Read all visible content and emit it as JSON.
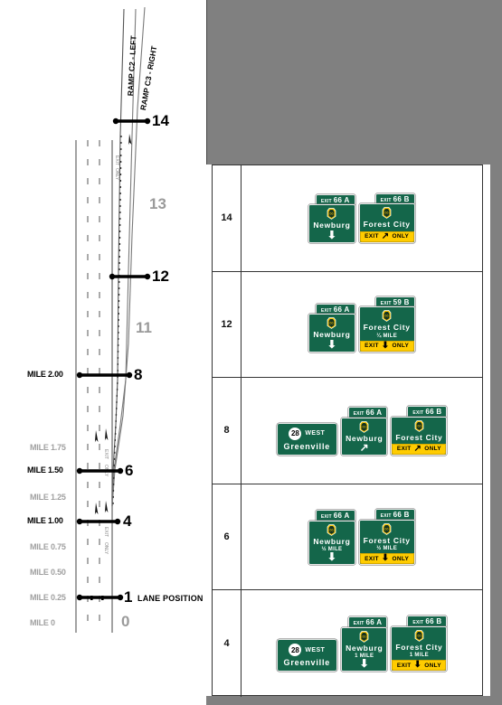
{
  "figure": {
    "kind": "freeway-exit-signing-diagram",
    "lane_position_caption": "LANE POSITION"
  },
  "diagram": {
    "ramp_labels": [
      {
        "id": "ramp-c2-left",
        "text": "RAMP C2 - LEFT"
      },
      {
        "id": "ramp-c3-right",
        "text": "RAMP C3 - RIGHT"
      }
    ],
    "mile_marks": [
      {
        "id": "mile-2-00",
        "text": "MILE 2.00",
        "emphasis": "major"
      },
      {
        "id": "mile-1-75",
        "text": "MILE 1.75",
        "emphasis": "minor"
      },
      {
        "id": "mile-1-50",
        "text": "MILE 1.50",
        "emphasis": "major"
      },
      {
        "id": "mile-1-25",
        "text": "MILE 1.25",
        "emphasis": "minor"
      },
      {
        "id": "mile-1-00",
        "text": "MILE 1.00",
        "emphasis": "major"
      },
      {
        "id": "mile-0-75",
        "text": "MILE 0.75",
        "emphasis": "minor"
      },
      {
        "id": "mile-0-50",
        "text": "MILE 0.50",
        "emphasis": "minor"
      },
      {
        "id": "mile-0-25",
        "text": "MILE 0.25",
        "emphasis": "minor"
      },
      {
        "id": "mile-0",
        "text": "MILE 0",
        "emphasis": "minor"
      }
    ],
    "position_numbers": [
      {
        "id": "pos-14",
        "text": "14",
        "emphasis": "major"
      },
      {
        "id": "pos-13",
        "text": "13",
        "emphasis": "minor"
      },
      {
        "id": "pos-12",
        "text": "12",
        "emphasis": "major"
      },
      {
        "id": "pos-11",
        "text": "11",
        "emphasis": "minor"
      },
      {
        "id": "pos-8",
        "text": "8",
        "emphasis": "major"
      },
      {
        "id": "pos-6",
        "text": "6",
        "emphasis": "major"
      },
      {
        "id": "pos-4",
        "text": "4",
        "emphasis": "major"
      },
      {
        "id": "pos-1",
        "text": "1",
        "emphasis": "major"
      },
      {
        "id": "pos-0",
        "text": "0",
        "emphasis": "minor"
      }
    ]
  },
  "table": {
    "rows": [
      {
        "position": "14",
        "signs": [
          {
            "type": "guide",
            "exit_tab": {
              "word": "EXIT",
              "number": "66 A"
            },
            "tab_align": "right",
            "shield": "keystone-shield-icon",
            "destination": "Newburg",
            "distance": "",
            "arrow": "down",
            "exit_only": null
          },
          {
            "type": "guide",
            "exit_tab": {
              "word": "EXIT",
              "number": "66 B"
            },
            "tab_align": "right",
            "shield": "keystone-shield-icon",
            "destination": "Forest City",
            "distance": "",
            "arrow": null,
            "exit_only": {
              "left": "EXIT",
              "arrow": "diagonal",
              "right": "ONLY"
            }
          }
        ]
      },
      {
        "position": "12",
        "signs": [
          {
            "type": "guide",
            "exit_tab": {
              "word": "EXIT",
              "number": "66 A"
            },
            "tab_align": "right",
            "shield": "keystone-shield-icon",
            "destination": "Newburg",
            "distance": "",
            "arrow": "down",
            "exit_only": null
          },
          {
            "type": "guide",
            "exit_tab": {
              "word": "EXIT",
              "number": "59 B"
            },
            "tab_align": "right",
            "shield": "keystone-shield-icon",
            "destination": "Forest City",
            "distance": "¼ MILE",
            "arrow": null,
            "exit_only": {
              "left": "EXIT",
              "arrow": "down",
              "right": "ONLY"
            }
          }
        ]
      },
      {
        "position": "8",
        "signs": [
          {
            "type": "route",
            "route_number": "28",
            "direction": "WEST",
            "destination": "Greenville"
          },
          {
            "type": "guide",
            "exit_tab": {
              "word": "EXIT",
              "number": "66 A"
            },
            "tab_align": "right",
            "shield": "keystone-shield-icon",
            "destination": "Newburg",
            "distance": "",
            "arrow": "diagonal",
            "exit_only": null
          },
          {
            "type": "guide",
            "exit_tab": {
              "word": "EXIT",
              "number": "66 B"
            },
            "tab_align": "right",
            "shield": "keystone-shield-icon",
            "destination": "Forest City",
            "distance": "",
            "arrow": null,
            "exit_only": {
              "left": "EXIT",
              "arrow": "diagonal",
              "right": "ONLY"
            }
          }
        ]
      },
      {
        "position": "6",
        "signs": [
          {
            "type": "guide",
            "exit_tab": {
              "word": "EXIT",
              "number": "66 A"
            },
            "tab_align": "right",
            "shield": "keystone-shield-icon",
            "destination": "Newburg",
            "distance": "½ MILE",
            "arrow": "down",
            "exit_only": null
          },
          {
            "type": "guide",
            "exit_tab": {
              "word": "EXIT",
              "number": "66 B"
            },
            "tab_align": "right",
            "shield": "keystone-shield-icon",
            "destination": "Forest City",
            "distance": "½ MILE",
            "arrow": null,
            "exit_only": {
              "left": "EXIT",
              "arrow": "down",
              "right": "ONLY"
            }
          }
        ]
      },
      {
        "position": "4",
        "signs": [
          {
            "type": "route",
            "route_number": "28",
            "direction": "WEST",
            "destination": "Greenville"
          },
          {
            "type": "guide",
            "exit_tab": {
              "word": "EXIT",
              "number": "66 A"
            },
            "tab_align": "right",
            "shield": "keystone-shield-icon",
            "destination": "Newburg",
            "distance": "1 MILE",
            "arrow": "down",
            "exit_only": null
          },
          {
            "type": "guide",
            "exit_tab": {
              "word": "EXIT",
              "number": "66 B"
            },
            "tab_align": "right",
            "shield": "keystone-shield-icon",
            "destination": "Forest City",
            "distance": "1 MILE",
            "arrow": null,
            "exit_only": {
              "left": "EXIT",
              "arrow": "down",
              "right": "ONLY"
            }
          }
        ]
      }
    ]
  },
  "colors": {
    "sign_green": "#14664a",
    "exit_only_yellow": "#FFCC00",
    "panel_grey": "#808080",
    "minor_label_grey": "#a0a0a0"
  }
}
